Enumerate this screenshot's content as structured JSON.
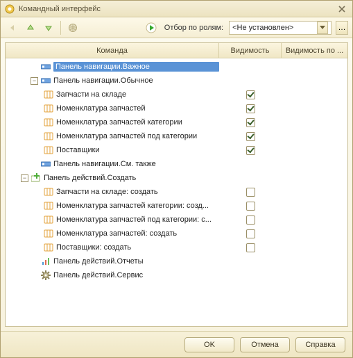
{
  "window": {
    "title": "Командный интерфейс"
  },
  "filter": {
    "label": "Отбор по ролям:",
    "value": "<Не установлен>"
  },
  "columns": {
    "command": "Команда",
    "visibility": "Видимость",
    "visibility_by": "Видимость по ..."
  },
  "tree": [
    {
      "depth": 1,
      "toggle": null,
      "icon": "panel-blue",
      "label": "Панель навигации.Важное",
      "selected": true,
      "check": null
    },
    {
      "depth": 1,
      "toggle": "minus",
      "icon": "panel-blue",
      "label": "Панель навигации.Обычное",
      "check": null
    },
    {
      "depth": 2,
      "toggle": null,
      "icon": "catalog",
      "label": "Запчасти на складе",
      "check": true
    },
    {
      "depth": 2,
      "toggle": null,
      "icon": "catalog",
      "label": "Номенклатура запчастей",
      "check": true
    },
    {
      "depth": 2,
      "toggle": null,
      "icon": "catalog",
      "label": "Номенклатура запчастей категории",
      "check": true
    },
    {
      "depth": 2,
      "toggle": null,
      "icon": "catalog",
      "label": "Номенклатура запчастей под категории",
      "check": true
    },
    {
      "depth": 2,
      "toggle": null,
      "icon": "catalog",
      "label": "Поставщики",
      "check": true
    },
    {
      "depth": 1,
      "toggle": null,
      "icon": "panel-blue",
      "label": "Панель навигации.См. также",
      "check": null
    },
    {
      "depth": 1,
      "toggle": "minus",
      "icon": "panel-create",
      "label": "Панель действий.Создать",
      "check": null,
      "root": true
    },
    {
      "depth": 2,
      "toggle": null,
      "icon": "catalog",
      "label": "Запчасти на складе: создать",
      "check": false
    },
    {
      "depth": 2,
      "toggle": null,
      "icon": "catalog",
      "label": "Номенклатура запчастей категории: созд...",
      "check": false
    },
    {
      "depth": 2,
      "toggle": null,
      "icon": "catalog",
      "label": "Номенклатура запчастей под категории: с...",
      "check": false
    },
    {
      "depth": 2,
      "toggle": null,
      "icon": "catalog",
      "label": "Номенклатура запчастей: создать",
      "check": false
    },
    {
      "depth": 2,
      "toggle": null,
      "icon": "catalog",
      "label": "Поставщики: создать",
      "check": false
    },
    {
      "depth": 1,
      "toggle": null,
      "icon": "report",
      "label": "Панель действий.Отчеты",
      "check": null
    },
    {
      "depth": 1,
      "toggle": null,
      "icon": "gear",
      "label": "Панель действий.Сервис",
      "check": null
    }
  ],
  "buttons": {
    "ok": "OK",
    "cancel": "Отмена",
    "help": "Справка"
  }
}
